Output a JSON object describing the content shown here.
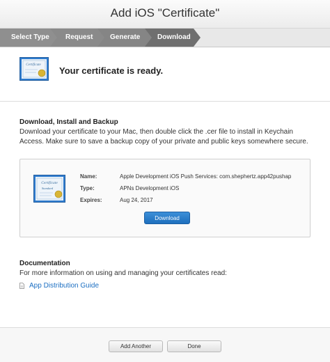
{
  "window": {
    "title": "Add iOS \"Certificate\""
  },
  "steps": [
    {
      "label": "Select Type"
    },
    {
      "label": "Request"
    },
    {
      "label": "Generate"
    },
    {
      "label": "Download"
    }
  ],
  "status": {
    "message": "Your certificate is ready."
  },
  "download_section": {
    "title": "Download, Install and Backup",
    "description": "Download your certificate to your Mac, then double click the .cer file to install in Keychain Access. Make sure to save a backup copy of your private and public keys somewhere secure."
  },
  "certificate": {
    "name_label": "Name:",
    "name_value": "Apple Development iOS Push Services: com.shephertz.app42pushap",
    "type_label": "Type:",
    "type_value": "APNs Development iOS",
    "expires_label": "Expires:",
    "expires_value": "Aug 24, 2017",
    "icon_text_top": "Certificate",
    "icon_text_bottom": "Standard",
    "download_label": "Download"
  },
  "documentation": {
    "title": "Documentation",
    "description": "For more information on using and managing your certificates read:",
    "link_label": "App Distribution Guide"
  },
  "footer": {
    "add_another_label": "Add Another",
    "done_label": "Done"
  },
  "colors": {
    "accent_blue": "#1e6fbd",
    "link_blue": "#1c6fc2",
    "step_active": "#6f6f6f"
  }
}
